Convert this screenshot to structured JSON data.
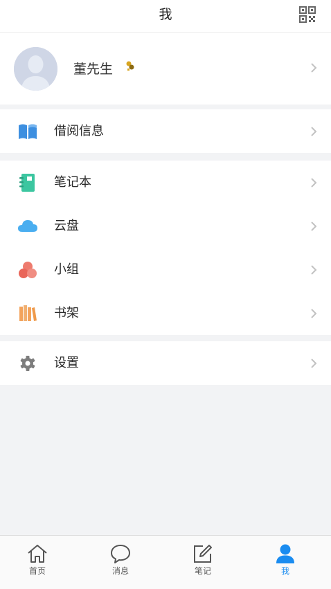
{
  "header": {
    "title": "我",
    "qr_icon": "qr-code-icon"
  },
  "profile": {
    "name": "董先生",
    "avatar_icon": "user-avatar",
    "badge_icon": "rank-badge-icon"
  },
  "menu": {
    "borrow": {
      "label": "借阅信息",
      "icon": "book-icon",
      "color": "#3d8fe0"
    },
    "notebook": {
      "label": "笔记本",
      "icon": "notebook-icon",
      "color": "#3cc6a0"
    },
    "cloud": {
      "label": "云盘",
      "icon": "cloud-icon",
      "color": "#4aaef0"
    },
    "group": {
      "label": "小组",
      "icon": "group-icon",
      "color": "#ee7b6e"
    },
    "bookshelf": {
      "label": "书架",
      "icon": "bookshelf-icon",
      "color": "#f3a35b"
    },
    "settings": {
      "label": "设置",
      "icon": "gear-icon",
      "color": "#7d7d7d"
    }
  },
  "tabbar": {
    "tabs": [
      {
        "label": "首页",
        "icon": "home-icon",
        "active": false
      },
      {
        "label": "消息",
        "icon": "message-icon",
        "active": false
      },
      {
        "label": "笔记",
        "icon": "note-edit-icon",
        "active": false
      },
      {
        "label": "我",
        "icon": "user-icon",
        "active": true
      }
    ],
    "active_color": "#1a8cf0"
  }
}
